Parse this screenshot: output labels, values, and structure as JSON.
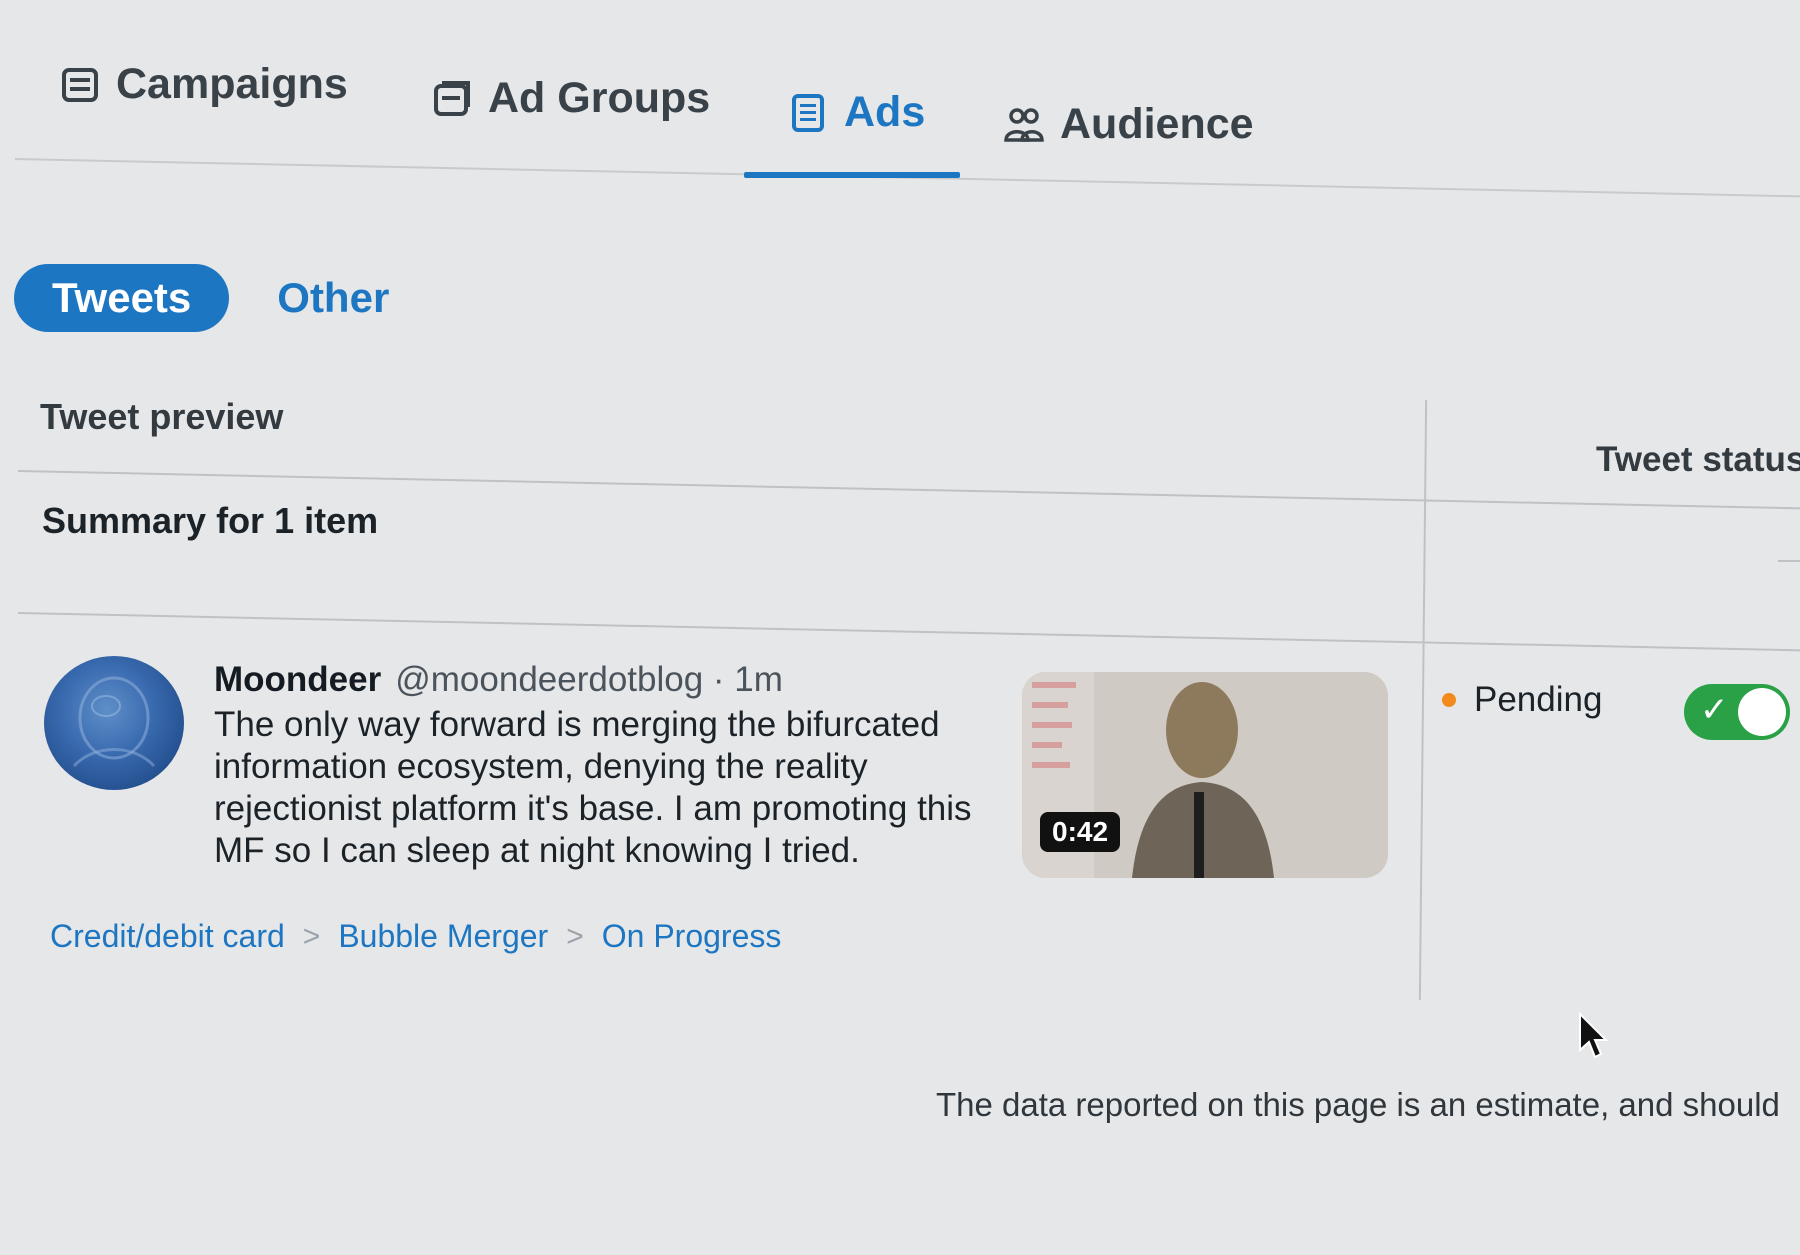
{
  "tabs": [
    {
      "label": "Campaigns",
      "icon": "campaigns-icon",
      "active": false
    },
    {
      "label": "Ad Groups",
      "icon": "ad-groups-icon",
      "active": false
    },
    {
      "label": "Ads",
      "icon": "ads-icon",
      "active": true
    },
    {
      "label": "Audience",
      "icon": "audience-icon",
      "active": false
    }
  ],
  "sub_tabs": {
    "active": "Tweets",
    "other": "Other"
  },
  "table": {
    "col_preview": "Tweet preview",
    "col_status": "Tweet status",
    "summary": "Summary for 1 item"
  },
  "tweet": {
    "author": "Moondeer",
    "meta": "@moondeerdotblog · 1m",
    "text": "The only way forward is merging the bifurcated information ecosystem, denying the reality rejectionist platform it's base. I am promoting this MF so I can sleep at night knowing I tried.",
    "video_duration": "0:42",
    "status": "Pending",
    "enabled": true,
    "breadcrumb": [
      "Credit/debit card",
      "Bubble Merger",
      "On Progress"
    ]
  },
  "footer_note": "The data reported on this page is an estimate, and should",
  "colors": {
    "accent": "#1d76c2",
    "pending": "#f28a1d",
    "toggle_on": "#2aa147"
  }
}
